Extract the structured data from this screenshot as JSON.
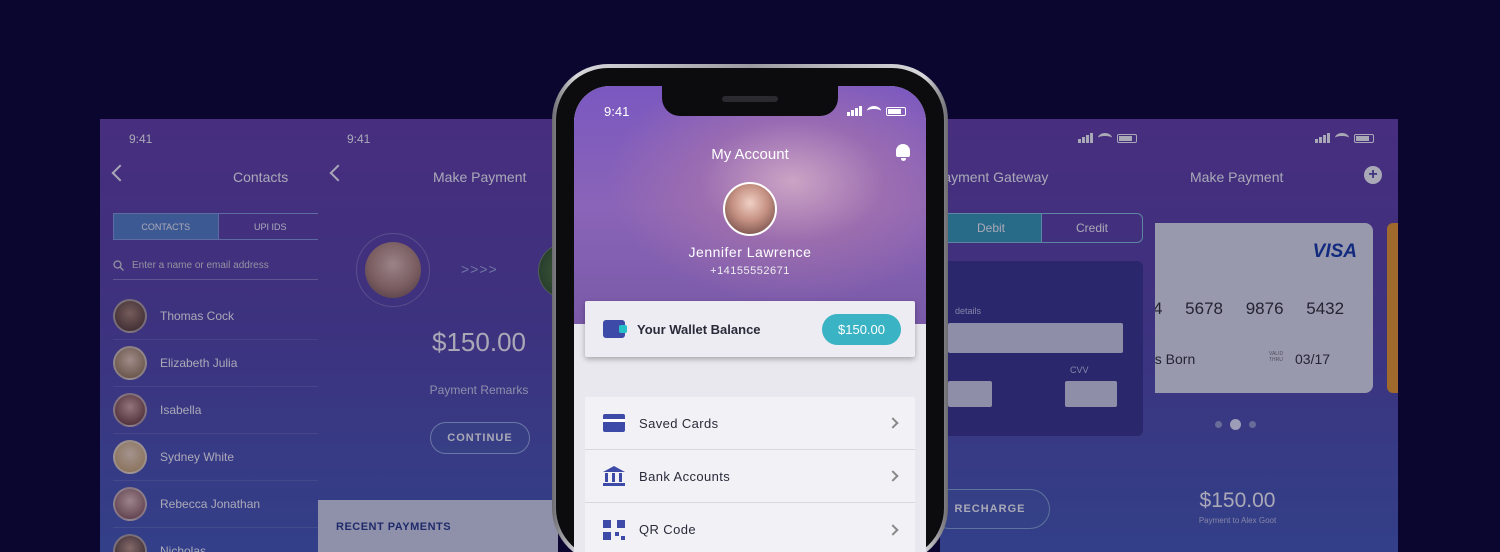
{
  "colors": {
    "background": "#0a0630",
    "accent": "#3ab3c4",
    "brand": "#3d4aa8"
  },
  "contacts_screen": {
    "time": "9:41",
    "title": "Contacts",
    "tabs": [
      "CONTACTS",
      "UPI IDS"
    ],
    "search_placeholder": "Enter a name or email address",
    "contacts": [
      "Thomas Cock",
      "Elizabeth Julia",
      "Isabella",
      "Sydney White",
      "Rebecca Jonathan",
      "Nicholas"
    ]
  },
  "payment_screen": {
    "time": "9:41",
    "title": "Make Payment",
    "arrows": ">>>>",
    "amount": "$150.00",
    "remarks": "Payment Remarks",
    "continue_label": "CONTINUE",
    "recent_label": "RECENT PAYMENTS"
  },
  "phone": {
    "time": "9:41",
    "title": "My Account",
    "user_name": "Jennifer Lawrence",
    "user_phone": "+14155552671",
    "wallet_label": "Your Wallet Balance",
    "wallet_amount": "$150.00",
    "menu": [
      "Saved Cards",
      "Bank Accounts",
      "QR Code"
    ]
  },
  "gateway_screen": {
    "title": "Payment Gateway",
    "tabs": [
      "Debit",
      "Credit"
    ],
    "details_label": "details",
    "cvv_label": "CVV",
    "recharge_label": "RECHARGE"
  },
  "card_screen": {
    "title": "Make Payment",
    "card_brand": "VISA",
    "card_number": "4 5678 9876 5432",
    "card_holder": "es Born",
    "valid_label": "VALID THRU",
    "expiry": "03/17",
    "amount": "$150.00",
    "paid_to": "Payment to Alex Goot"
  }
}
